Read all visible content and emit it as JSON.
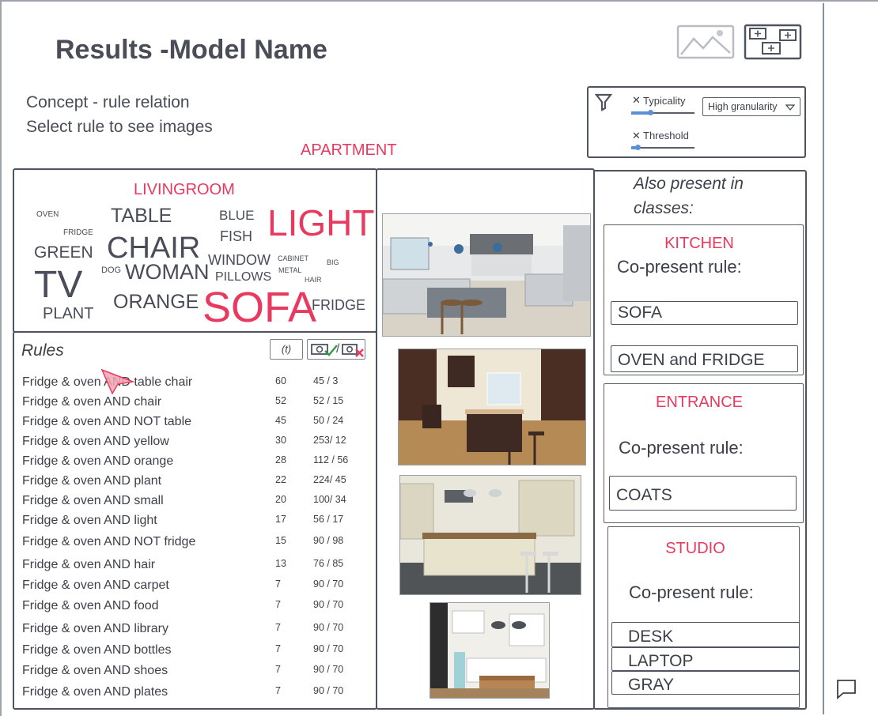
{
  "header": {
    "title": "Results -Model Name",
    "subtitle_line1": "Concept - rule relation",
    "subtitle_line2": "Select rule to see images",
    "concept": "APARTMENT"
  },
  "toolbar": {
    "image_icon": "image-icon",
    "layout_icon": "layout-grid-icon"
  },
  "filters": {
    "funnel_icon": "funnel-icon",
    "typicality_label": "Typicality",
    "threshold_label": "Threshold",
    "granularity_value": "High granularity",
    "typicality_level": 0.3,
    "threshold_level": 0.1
  },
  "wordcloud": {
    "title": "LIVINGROOM",
    "words": [
      {
        "text": "OVEN"
      },
      {
        "text": "FRIDGE"
      },
      {
        "text": "GREEN"
      },
      {
        "text": "TABLE"
      },
      {
        "text": "CHAIR"
      },
      {
        "text": "DOG"
      },
      {
        "text": "WOMAN"
      },
      {
        "text": "TV"
      },
      {
        "text": "PLANT"
      },
      {
        "text": "ORANGE"
      },
      {
        "text": "BLUE"
      },
      {
        "text": "FISH"
      },
      {
        "text": "WINDOW"
      },
      {
        "text": "PILLOWS"
      },
      {
        "text": "CABINET"
      },
      {
        "text": "METAL"
      },
      {
        "text": "HAIR"
      },
      {
        "text": "BIG"
      },
      {
        "text": "LIGHT"
      },
      {
        "text": "SOFA"
      },
      {
        "text": "FRIDGE"
      }
    ]
  },
  "rules": {
    "title": "Rules",
    "t_button": "(t)",
    "rows": [
      {
        "text": "Fridge & oven AND table chair",
        "a": "60",
        "b": "45 / 3"
      },
      {
        "text": "Fridge & oven AND chair",
        "a": "52",
        "b": "52 / 15"
      },
      {
        "text": "Fridge & oven AND NOT table",
        "a": "45",
        "b": "50 / 24"
      },
      {
        "text": "Fridge & oven AND yellow",
        "a": "30",
        "b": "253/ 12"
      },
      {
        "text": "Fridge & oven AND orange",
        "a": "28",
        "b": "112 / 56"
      },
      {
        "text": "Fridge & oven AND plant",
        "a": "22",
        "b": "224/ 45"
      },
      {
        "text": "Fridge & oven AND small",
        "a": "20",
        "b": "100/ 34"
      },
      {
        "text": "Fridge & oven AND light",
        "a": "17",
        "b": "56 / 17"
      },
      {
        "text": "Fridge & oven AND NOT fridge",
        "a": "15",
        "b": "90 / 98"
      },
      {
        "text": "Fridge & oven AND hair",
        "a": "13",
        "b": "76 / 85"
      },
      {
        "text": "Fridge & oven AND carpet",
        "a": "7",
        "b": "90 / 70"
      },
      {
        "text": "Fridge & oven AND food",
        "a": "7",
        "b": "90 / 70"
      },
      {
        "text": "Fridge & oven AND library",
        "a": "7",
        "b": "90 / 70"
      },
      {
        "text": "Fridge & oven AND bottles",
        "a": "7",
        "b": "90 / 70"
      },
      {
        "text": "Fridge & oven AND shoes",
        "a": "7",
        "b": "90 / 70"
      },
      {
        "text": "Fridge & oven AND plates",
        "a": "7",
        "b": "90 / 70"
      }
    ]
  },
  "also_present": {
    "title_line1": "Also present in",
    "title_line2": "classes:",
    "co_label": "Co-present rule:",
    "classes": [
      {
        "name": "KITCHEN",
        "rules": [
          "SOFA",
          "OVEN and FRIDGE"
        ]
      },
      {
        "name": "ENTRANCE",
        "rules": [
          "COATS"
        ]
      },
      {
        "name": "STUDIO",
        "rules": [
          "DESK",
          "LAPTOP",
          "GRAY"
        ]
      }
    ]
  },
  "footer": {
    "comment_icon": "comment-icon"
  },
  "colors": {
    "accent": "#e8395f",
    "ink": "#4f5360"
  }
}
